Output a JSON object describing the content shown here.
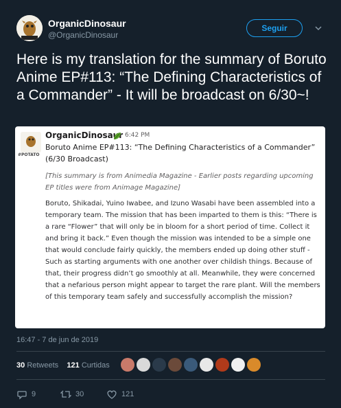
{
  "profile": {
    "name": "OrganicDinosaur",
    "handle": "@OrganicDinosaur",
    "follow_label": "Seguir"
  },
  "tweet": {
    "text": "Here is my translation for the summary of Boruto Anime EP#113: “The Defining Characteristics of a Commander” - It will be broadcast on 6/30~!",
    "timestamp": "16:47 - 7 de jun de 2019"
  },
  "card": {
    "author": "OrganicDinosaur",
    "time": "6:42 PM",
    "avatar_caption": "#POTATO",
    "title": "Boruto Anime EP#113: “The Defining Characteristics of a Commander” (6/30 Broadcast)",
    "note": "[This summary is from Animedia Magazine - Earlier posts regarding upcoming EP titles were from Animage Magazine]",
    "body": "Boruto, Shikadai, Yuino Iwabee, and Izuno Wasabi have been assembled into a temporary team. The mission that has been imparted to them is this: “There is a rare “Flower” that will only be in bloom for a short period of time. Collect it and bring it back.” Even though the mission was intended to be a simple one that would conclude fairly quickly, the members ended up doing other stuff - Such as starting arguments with one another over childish things. Because of that, their progress didn’t go smoothly at all. Meanwhile, they were concerned that a nefarious person might appear to target the rare plant. Will the members of this temporary team safely and successfully accomplish the mission?"
  },
  "stats": {
    "retweets_count": "30",
    "retweets_label": "Retweets",
    "likes_count": "121",
    "likes_label": "Curtidas"
  },
  "actions": {
    "reply_count": "9",
    "retweet_count": "30",
    "like_count": "121"
  },
  "colors": {
    "background": "#15202b",
    "accent": "#1da1f2",
    "muted": "#8899a6",
    "divider": "#38444d"
  },
  "icons": [
    "chevron-down-icon",
    "leaf-icon",
    "reply-icon",
    "retweet-icon",
    "heart-icon"
  ]
}
